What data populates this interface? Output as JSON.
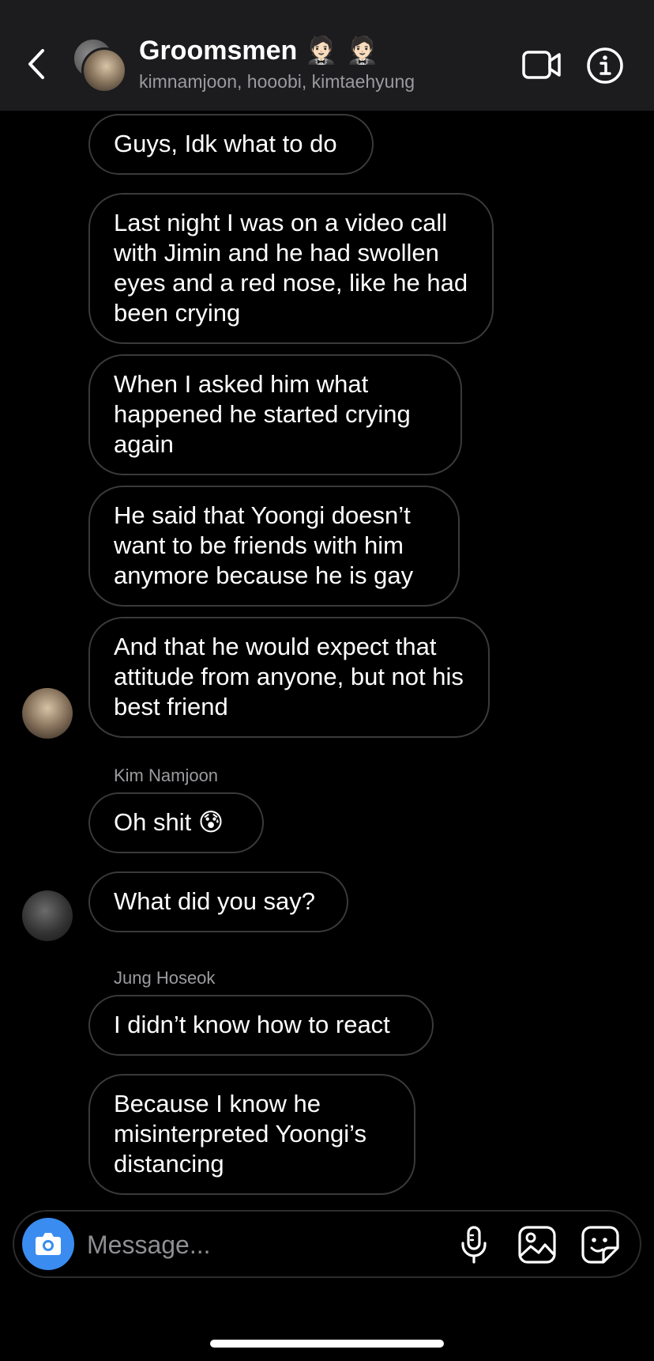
{
  "header": {
    "title": "Groomsmen 🤵🏻 🤵🏻",
    "members": "kimnamjoon, hooobi, kimtaehyung",
    "icons": {
      "back": "chevron-left-icon",
      "video": "video-camera-icon",
      "info": "info-icon"
    }
  },
  "messages": [
    {
      "text": "Guys, Idk what to do"
    },
    {
      "text": "Last night I was on a video call with Jimin and he had swollen eyes and a red nose, like he had been crying"
    },
    {
      "text": "When I asked him what happened he started crying again"
    },
    {
      "text": "He said that Yoongi doesn’t want to be friends with him anymore because he is gay"
    },
    {
      "text": "And that he would expect that attitude from anyone, but not his best friend"
    },
    {
      "sender": "Kim Namjoon",
      "text": "Oh shit 😰"
    },
    {
      "text": "What did you say?"
    },
    {
      "sender": "Jung Hoseok",
      "text": "I didn’t know how to react"
    },
    {
      "text": "Because I know he misinterpreted Yoongi’s distancing"
    }
  ],
  "composer": {
    "placeholder": "Message...",
    "icons": {
      "camera": "camera-icon",
      "mic": "microphone-icon",
      "gallery": "image-icon",
      "sticker": "sticker-icon"
    }
  },
  "colors": {
    "accent": "#3a8cf0",
    "bubble_border": "#3a3a3c",
    "header_bg": "#1c1c1e"
  }
}
